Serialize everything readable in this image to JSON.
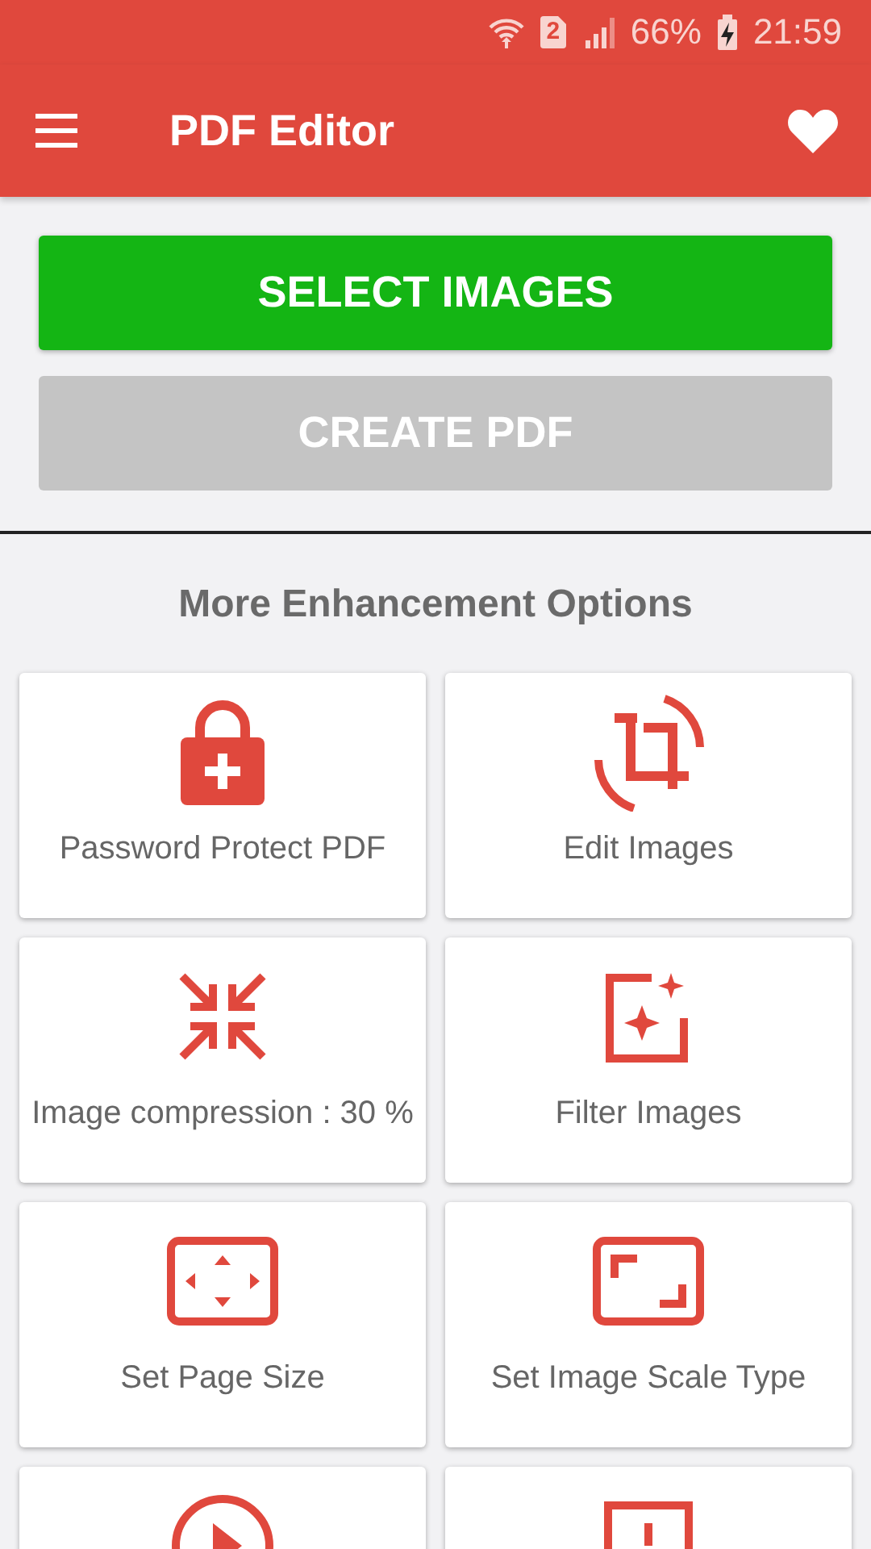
{
  "status_bar": {
    "sim_slot": "2",
    "battery": "66%",
    "time": "21:59"
  },
  "app_bar": {
    "title": "PDF Editor"
  },
  "buttons": [
    {
      "label": "SELECT IMAGES",
      "disabled": false
    },
    {
      "label": "CREATE PDF",
      "disabled": true
    }
  ],
  "section_title": "More Enhancement Options",
  "options": [
    {
      "kind": "lock",
      "label": "Password Protect PDF"
    },
    {
      "kind": "crop",
      "label": "Edit Images"
    },
    {
      "kind": "compress",
      "label": "Image compression : 30 %"
    },
    {
      "kind": "filter",
      "label": "Filter Images"
    },
    {
      "kind": "page",
      "label": "Set Page Size"
    },
    {
      "kind": "scale",
      "label": "Set Image Scale Type"
    },
    {
      "kind": "play"
    },
    {
      "kind": "frame"
    }
  ]
}
